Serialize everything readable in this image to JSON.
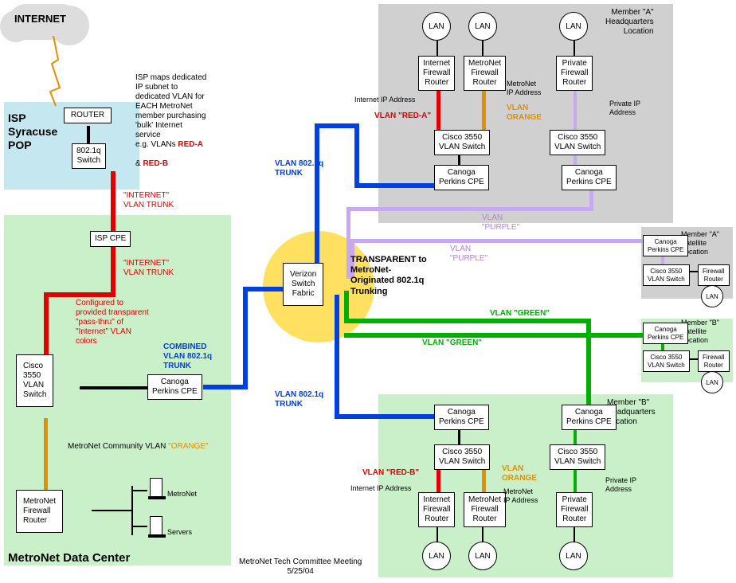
{
  "internet_label": "INTERNET",
  "isp_pop": {
    "title": "ISP\nSyracuse\nPOP",
    "router": "ROUTER",
    "switch": "802.1q\nSwitch"
  },
  "isp_note": "ISP maps dedicated\nIP subnet to\ndedicated VLAN for\nEACH MetroNet\nmember purchasing\n'bulk' Internet\nservice\ne.g. VLANs ",
  "isp_note_reda": "RED-A",
  "isp_note_amp": " & ",
  "isp_note_redb": "RED-B",
  "internet_vlan_trunk": "\"INTERNET\"\nVLAN TRUNK",
  "isp_cpe": "ISP CPE",
  "dc": {
    "title": "MetroNet Data Center",
    "passthru_note": "Configured to\nprovided transparent\n\"pass-thru\" of\n\"Internet\" VLAN\ncolors",
    "cisco": "Cisco\n3550\nVLAN\nSwitch",
    "canoga": "Canoga\nPerkins CPE",
    "community_vlan": "MetroNet Community\nVLAN ",
    "community_vlan_orange": "\"ORANGE\"",
    "firewall": "MetroNet\nFirewall\nRouter",
    "metronet_server": "MetroNet",
    "servers_label": "Servers"
  },
  "combined_trunk": "COMBINED\nVLAN 802.1q\nTRUNK",
  "verizon": "Verizon\nSwitch\nFabric",
  "transparent_note": "TRANSPARENT to\nMetroNet-\nOriginated 802.1q\nTrunking",
  "vlan_trunk": "VLAN 802.1q\nTRUNK",
  "vlan_purple": "VLAN\n\"PURPLE\"",
  "vlan_green": "VLAN \"GREEN\"",
  "vlan_red_a": "VLAN \"RED-A\"",
  "vlan_red_b": "VLAN \"RED-B\"",
  "vlan_orange": "VLAN\nORANGE",
  "internet_ip": "Internet IP Address",
  "metronet_ip": "MetroNet\nIP Address",
  "private_ip": "Private IP\nAddress",
  "member_a_hq": {
    "title": "Member \"A\"\nHeadquarters\nLocation",
    "internet_fw": "Internet\nFirewall\nRouter",
    "metronet_fw": "MetroNet\nFirewall\nRouter",
    "private_fw": "Private\nFirewall\nRouter",
    "cisco": "Cisco 3550\nVLAN Switch",
    "canoga": "Canoga\nPerkins CPE"
  },
  "member_a_sat": {
    "title": "Member \"A\"\nSatellite\nLocation",
    "canoga": "Canoga\nPerkins CPE",
    "cisco": "Cisco 3550\nVLAN Switch",
    "fw": "Firewall\nRouter"
  },
  "member_b_sat": {
    "title": "Member \"B\"\nSatellite\nLocation",
    "canoga": "Canoga\nPerkins CPE",
    "cisco": "Cisco 3550\nVLAN Switch",
    "fw": "Firewall\nRouter"
  },
  "member_b_hq": {
    "title": "Member \"B\"\nHeadquarters\nLocation",
    "internet_fw": "Internet\nFirewall\nRouter",
    "metronet_fw": "MetroNet\nFirewall\nRouter",
    "private_fw": "Private\nFirewall\nRouter",
    "cisco": "Cisco 3550\nVLAN Switch",
    "canoga": "Canoga\nPerkins CPE"
  },
  "lan": "LAN",
  "footer": "MetroNet Tech Committee Meeting\n5/25/04"
}
